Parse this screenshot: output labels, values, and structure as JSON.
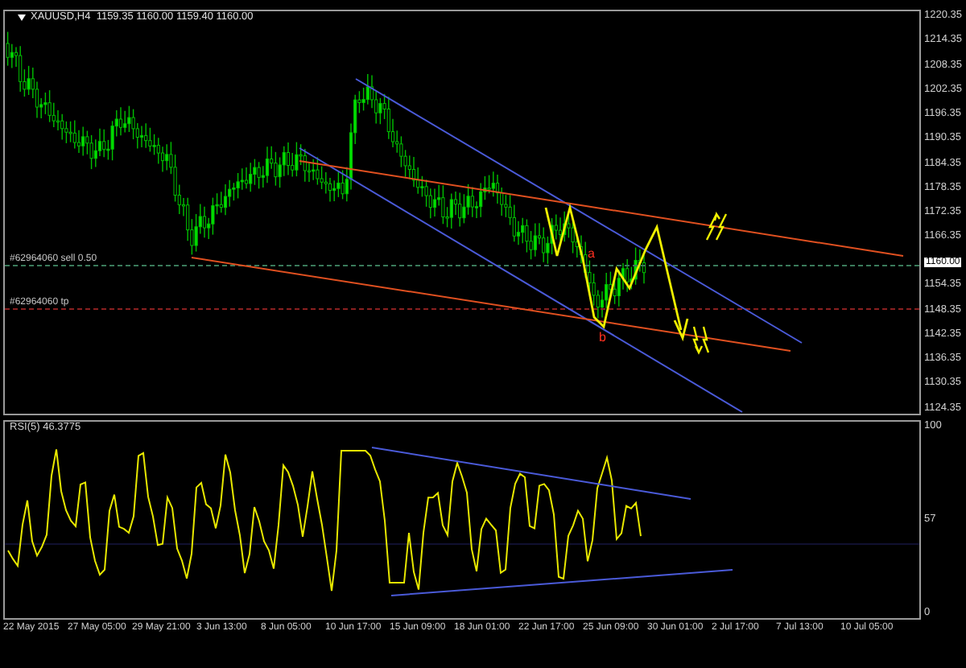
{
  "main_chart": {
    "title": "XAUUSD,H4  1159.35 1160.00 1159.40 1160.00",
    "order_lines": [
      {
        "kind": "sell",
        "label": "#62964060 sell 0.50"
      },
      {
        "kind": "tp",
        "label": "#62964060 tp"
      }
    ],
    "wave_labels": [
      "a",
      "b"
    ],
    "price_axis": [
      {
        "kind": "tick",
        "label": "1220.35"
      },
      {
        "kind": "tick",
        "label": "1214.35"
      },
      {
        "kind": "tick",
        "label": "1208.35"
      },
      {
        "kind": "tick",
        "label": "1202.35"
      },
      {
        "kind": "tick",
        "label": "1196.35"
      },
      {
        "kind": "tick",
        "label": "1190.35"
      },
      {
        "kind": "tick",
        "label": "1184.35"
      },
      {
        "kind": "tick",
        "label": "1178.35"
      },
      {
        "kind": "tick",
        "label": "1172.35"
      },
      {
        "kind": "tick",
        "label": "1166.35"
      },
      {
        "kind": "current",
        "label": "1160.00"
      },
      {
        "kind": "tick",
        "label": "1154.35"
      },
      {
        "kind": "tick",
        "label": "1148.35"
      },
      {
        "kind": "tick",
        "label": "1142.35"
      },
      {
        "kind": "tick",
        "label": "1136.35"
      },
      {
        "kind": "tick",
        "label": "1130.35"
      },
      {
        "kind": "tick",
        "label": "1124.35"
      }
    ]
  },
  "rsi_panel": {
    "title": "RSI(5) 46.3775",
    "axis": [
      "100",
      "57",
      "0"
    ]
  },
  "time_axis": [
    "22 May 2015",
    "27 May 05:00",
    "29 May 21:00",
    "3 Jun 13:00",
    "8 Jun 05:00",
    "10 Jun 17:00",
    "15 Jun 09:00",
    "18 Jun 01:00",
    "22 Jun 17:00",
    "25 Jun 09:00",
    "30 Jun 01:00",
    "2 Jul 17:00",
    "7 Jul 13:00",
    "10 Jul 05:00"
  ]
}
